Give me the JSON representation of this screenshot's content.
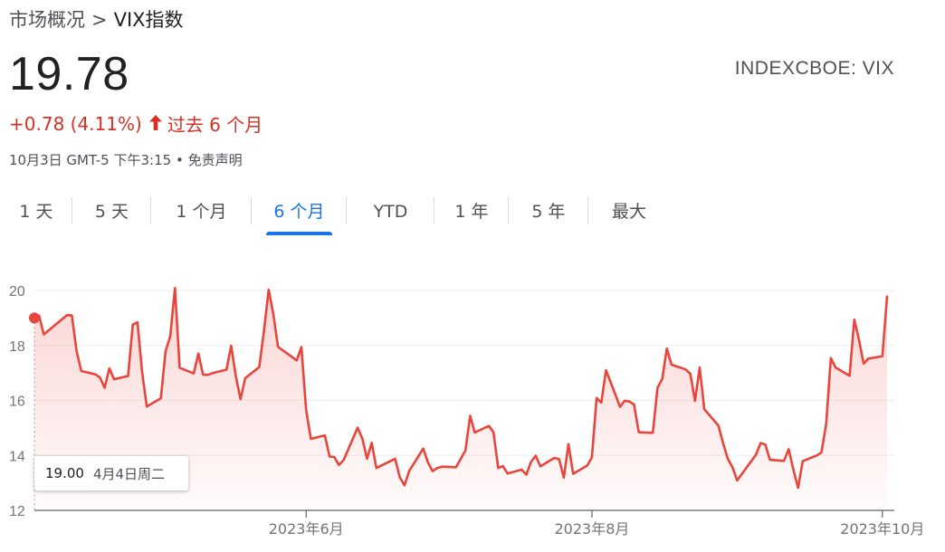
{
  "breadcrumb": {
    "root": "市场概况",
    "separator": ">",
    "current": "VIX指数"
  },
  "quote": {
    "price": "19.78",
    "ticker": "INDEXCBOE: VIX",
    "change_text": "+0.78 (4.11%)",
    "change_arrow_icon": "arrow-up-icon",
    "period_text": "过去 6 个月",
    "timestamp": "10月3日 GMT-5 下午3:15",
    "meta_separator": "•",
    "disclaimer": "免责声明"
  },
  "tabs": [
    {
      "label": "1 天",
      "active": false
    },
    {
      "label": "5 天",
      "active": false
    },
    {
      "label": "1 个月",
      "active": false
    },
    {
      "label": "6 个月",
      "active": true
    },
    {
      "label": "YTD",
      "active": false
    },
    {
      "label": "1 年",
      "active": false
    },
    {
      "label": "5 年",
      "active": false
    },
    {
      "label": "最大",
      "active": false
    }
  ],
  "tooltip": {
    "value": "19.00",
    "date": "4月4日周二"
  },
  "colors": {
    "accent": "#1a73e8",
    "negative": "#d93025",
    "line": "#e8453c"
  },
  "chart_data": {
    "type": "area",
    "title": "",
    "xlabel": "",
    "ylabel": "",
    "ylim": [
      12,
      20
    ],
    "yticks": [
      "12",
      "14",
      "16",
      "18",
      "20"
    ],
    "x_range": [
      "2023-04-04",
      "2023-10-03"
    ],
    "xticks": [
      {
        "date": "2023-06-01",
        "label": "2023年6月"
      },
      {
        "date": "2023-08-01",
        "label": "2023年8月"
      },
      {
        "date": "2023-10-02",
        "label": "2023年10月"
      }
    ],
    "grid": true,
    "highlight": {
      "date": "2023-04-04",
      "value": 19.0
    },
    "series": [
      {
        "values": [
          [
            "2023-04-04",
            19.0
          ],
          [
            "2023-04-05",
            19.08
          ],
          [
            "2023-04-06",
            18.4
          ],
          [
            "2023-04-10",
            18.97
          ],
          [
            "2023-04-11",
            19.1
          ],
          [
            "2023-04-12",
            19.09
          ],
          [
            "2023-04-13",
            17.8
          ],
          [
            "2023-04-14",
            17.07
          ],
          [
            "2023-04-17",
            16.95
          ],
          [
            "2023-04-18",
            16.83
          ],
          [
            "2023-04-19",
            16.46
          ],
          [
            "2023-04-20",
            17.17
          ],
          [
            "2023-04-21",
            16.77
          ],
          [
            "2023-04-24",
            16.89
          ],
          [
            "2023-04-25",
            18.76
          ],
          [
            "2023-04-26",
            18.84
          ],
          [
            "2023-04-27",
            17.03
          ],
          [
            "2023-04-28",
            15.78
          ],
          [
            "2023-05-01",
            16.08
          ],
          [
            "2023-05-02",
            17.78
          ],
          [
            "2023-05-03",
            18.34
          ],
          [
            "2023-05-04",
            20.09
          ],
          [
            "2023-05-05",
            17.19
          ],
          [
            "2023-05-08",
            16.98
          ],
          [
            "2023-05-09",
            17.71
          ],
          [
            "2023-05-10",
            16.94
          ],
          [
            "2023-05-11",
            16.93
          ],
          [
            "2023-05-12",
            16.99
          ],
          [
            "2023-05-15",
            17.12
          ],
          [
            "2023-05-16",
            17.99
          ],
          [
            "2023-05-17",
            16.87
          ],
          [
            "2023-05-18",
            16.05
          ],
          [
            "2023-05-19",
            16.81
          ],
          [
            "2023-05-22",
            17.21
          ],
          [
            "2023-05-23",
            18.53
          ],
          [
            "2023-05-24",
            20.03
          ],
          [
            "2023-05-25",
            19.14
          ],
          [
            "2023-05-26",
            17.95
          ],
          [
            "2023-05-30",
            17.46
          ],
          [
            "2023-05-31",
            17.94
          ],
          [
            "2023-06-01",
            15.65
          ],
          [
            "2023-06-02",
            14.6
          ],
          [
            "2023-06-05",
            14.73
          ],
          [
            "2023-06-06",
            13.96
          ],
          [
            "2023-06-07",
            13.94
          ],
          [
            "2023-06-08",
            13.65
          ],
          [
            "2023-06-09",
            13.83
          ],
          [
            "2023-06-12",
            15.01
          ],
          [
            "2023-06-13",
            14.61
          ],
          [
            "2023-06-14",
            13.88
          ],
          [
            "2023-06-15",
            14.46
          ],
          [
            "2023-06-16",
            13.54
          ],
          [
            "2023-06-20",
            13.88
          ],
          [
            "2023-06-21",
            13.2
          ],
          [
            "2023-06-22",
            12.91
          ],
          [
            "2023-06-23",
            13.44
          ],
          [
            "2023-06-26",
            14.25
          ],
          [
            "2023-06-27",
            13.74
          ],
          [
            "2023-06-28",
            13.43
          ],
          [
            "2023-06-29",
            13.54
          ],
          [
            "2023-06-30",
            13.59
          ],
          [
            "2023-07-03",
            13.57
          ],
          [
            "2023-07-05",
            14.18
          ],
          [
            "2023-07-06",
            15.44
          ],
          [
            "2023-07-07",
            14.83
          ],
          [
            "2023-07-10",
            15.07
          ],
          [
            "2023-07-11",
            14.84
          ],
          [
            "2023-07-12",
            13.54
          ],
          [
            "2023-07-13",
            13.61
          ],
          [
            "2023-07-14",
            13.34
          ],
          [
            "2023-07-17",
            13.48
          ],
          [
            "2023-07-18",
            13.3
          ],
          [
            "2023-07-19",
            13.76
          ],
          [
            "2023-07-20",
            13.99
          ],
          [
            "2023-07-21",
            13.6
          ],
          [
            "2023-07-24",
            13.91
          ],
          [
            "2023-07-25",
            13.86
          ],
          [
            "2023-07-26",
            13.19
          ],
          [
            "2023-07-27",
            14.41
          ],
          [
            "2023-07-28",
            13.33
          ],
          [
            "2023-07-31",
            13.63
          ],
          [
            "2023-08-01",
            13.93
          ],
          [
            "2023-08-02",
            16.09
          ],
          [
            "2023-08-03",
            15.92
          ],
          [
            "2023-08-04",
            17.1
          ],
          [
            "2023-08-07",
            15.77
          ],
          [
            "2023-08-08",
            15.99
          ],
          [
            "2023-08-09",
            15.96
          ],
          [
            "2023-08-10",
            15.85
          ],
          [
            "2023-08-11",
            14.84
          ],
          [
            "2023-08-14",
            14.82
          ],
          [
            "2023-08-15",
            16.46
          ],
          [
            "2023-08-16",
            16.78
          ],
          [
            "2023-08-17",
            17.89
          ],
          [
            "2023-08-18",
            17.3
          ],
          [
            "2023-08-21",
            17.13
          ],
          [
            "2023-08-22",
            16.97
          ],
          [
            "2023-08-23",
            15.98
          ],
          [
            "2023-08-24",
            17.2
          ],
          [
            "2023-08-25",
            15.68
          ],
          [
            "2023-08-28",
            15.08
          ],
          [
            "2023-08-29",
            14.45
          ],
          [
            "2023-08-30",
            13.88
          ],
          [
            "2023-08-31",
            13.57
          ],
          [
            "2023-09-01",
            13.09
          ],
          [
            "2023-09-05",
            14.02
          ],
          [
            "2023-09-06",
            14.45
          ],
          [
            "2023-09-07",
            14.4
          ],
          [
            "2023-09-08",
            13.84
          ],
          [
            "2023-09-11",
            13.8
          ],
          [
            "2023-09-12",
            14.23
          ],
          [
            "2023-09-13",
            13.48
          ],
          [
            "2023-09-14",
            12.82
          ],
          [
            "2023-09-15",
            13.79
          ],
          [
            "2023-09-18",
            14.0
          ],
          [
            "2023-09-19",
            14.11
          ],
          [
            "2023-09-20",
            15.14
          ],
          [
            "2023-09-21",
            17.54
          ],
          [
            "2023-09-22",
            17.2
          ],
          [
            "2023-09-25",
            16.9
          ],
          [
            "2023-09-26",
            18.94
          ],
          [
            "2023-09-27",
            18.22
          ],
          [
            "2023-09-28",
            17.34
          ],
          [
            "2023-09-29",
            17.52
          ],
          [
            "2023-10-02",
            17.61
          ],
          [
            "2023-10-03",
            19.78
          ]
        ]
      }
    ]
  }
}
